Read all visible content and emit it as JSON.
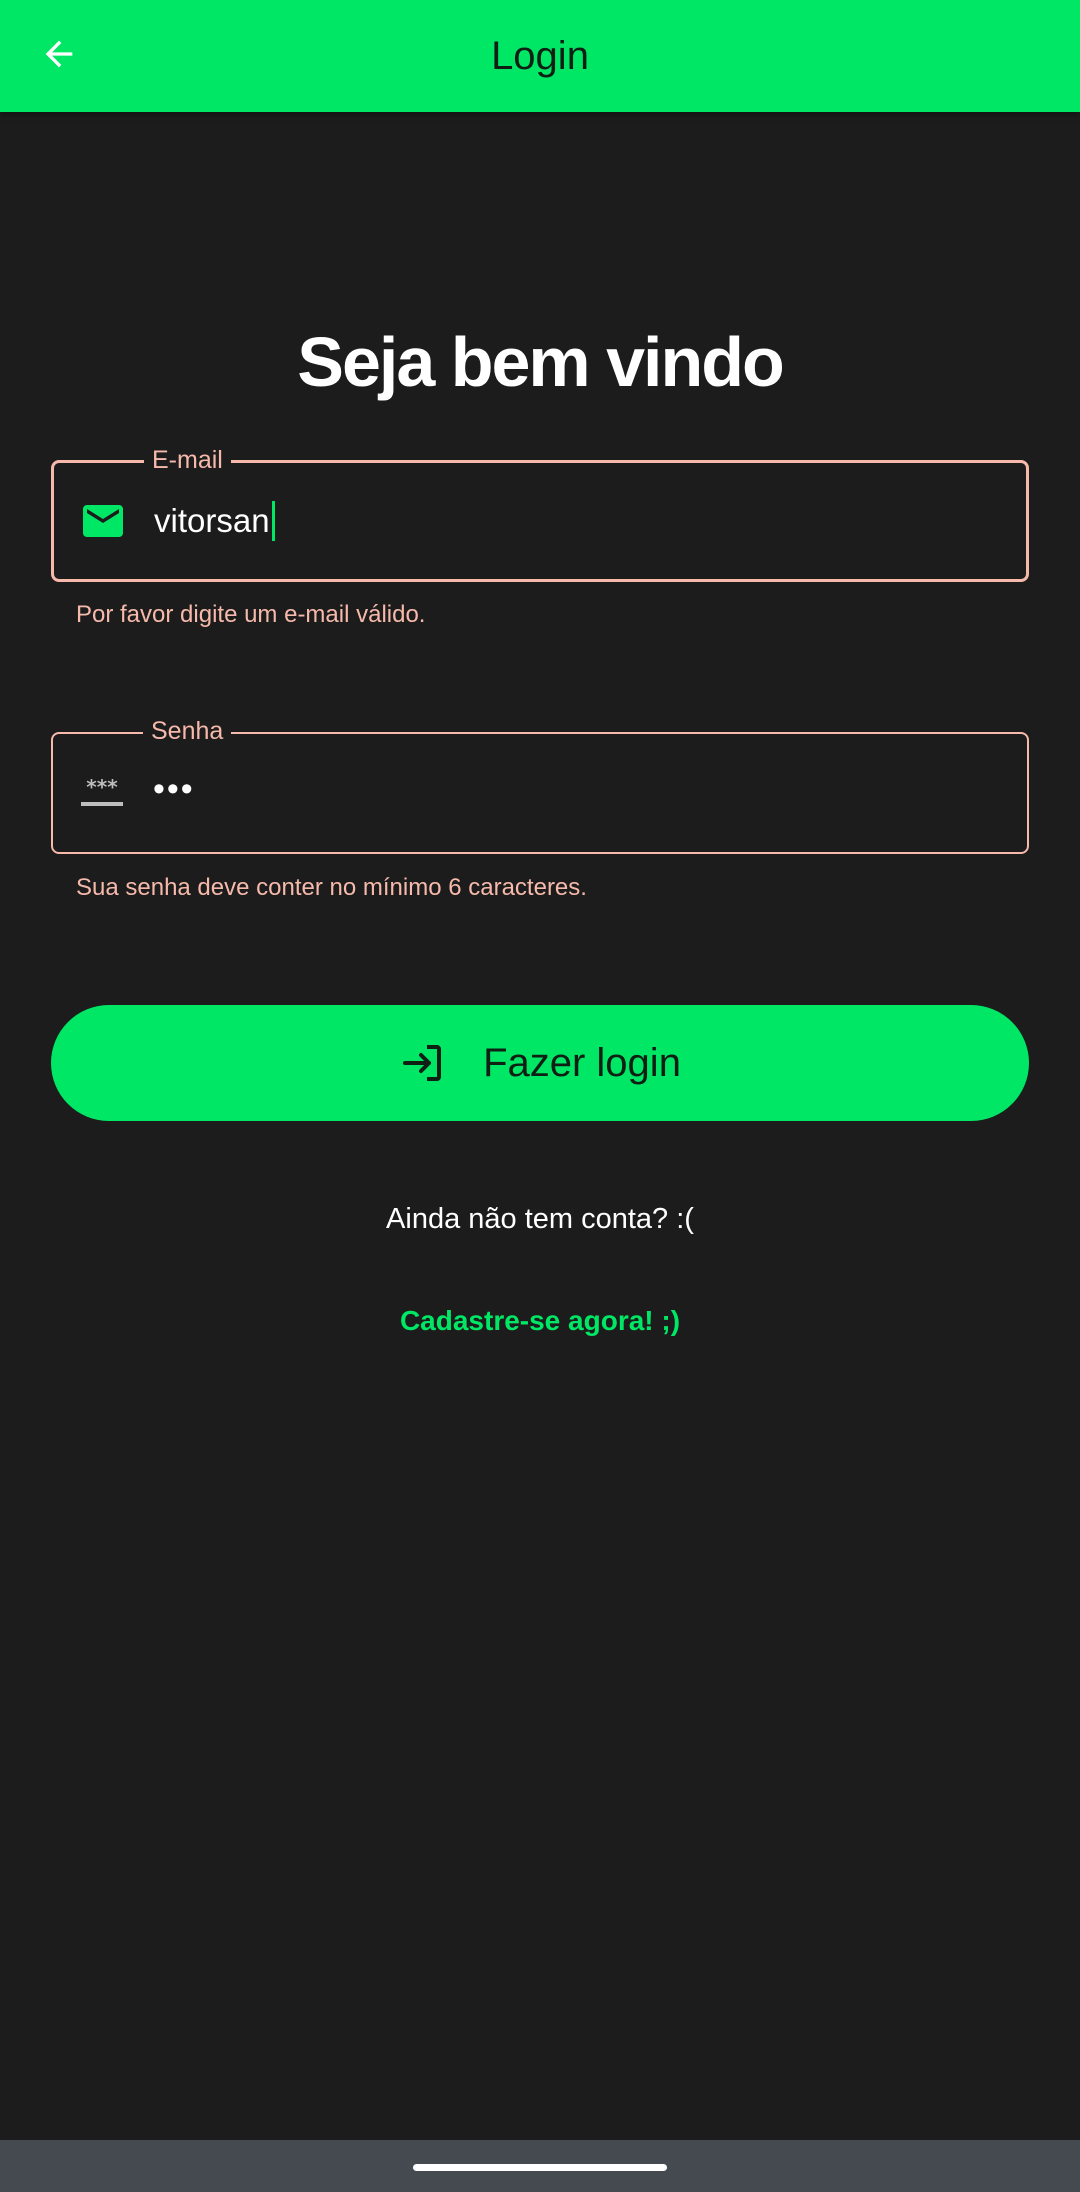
{
  "app_bar": {
    "title": "Login",
    "back_icon": "arrow-back-icon",
    "background": "#00e765"
  },
  "heading": "Seja bem vindo",
  "email_field": {
    "label": "E-mail",
    "value": "vitorsan",
    "icon": "mail-icon",
    "error": "Por favor digite um e-mail válido."
  },
  "password_field": {
    "label": "Senha",
    "value": "•••",
    "icon": "password-icon",
    "icon_text": "***",
    "error": "Sua senha deve conter no mínimo 6 caracteres."
  },
  "login_button": {
    "label": "Fazer login",
    "icon": "login-icon"
  },
  "no_account_text": "Ainda não tem conta? :(",
  "signup_link": "Cadastre-se agora! ;)",
  "colors": {
    "accent": "#00e765",
    "error": "#f6b9ab",
    "background": "#1b1c1b",
    "nav_bar": "#454a50"
  }
}
